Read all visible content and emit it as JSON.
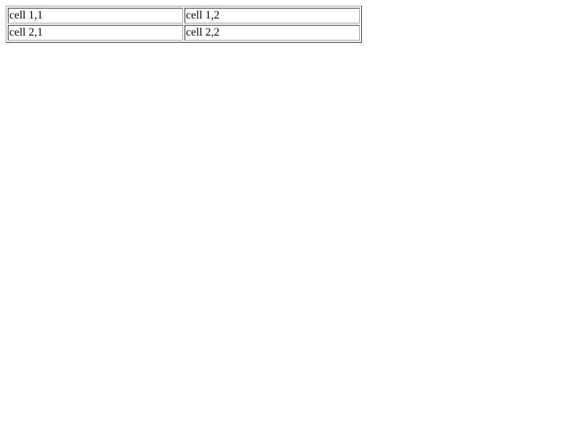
{
  "table": {
    "rows": [
      {
        "cells": [
          "cell 1,1",
          "cell 1,2"
        ]
      },
      {
        "cells": [
          "cell 2,1",
          "cell 2,2"
        ]
      }
    ]
  }
}
